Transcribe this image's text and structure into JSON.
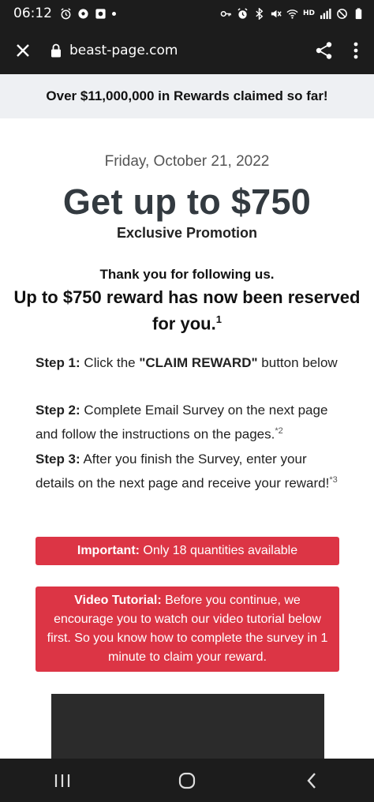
{
  "status_bar": {
    "time": "06:12",
    "hd_label": "HD",
    "icons_left": [
      "alarm-icon",
      "soccer-ball-icon",
      "app-notification-icon",
      "dot-icon"
    ],
    "icons_right": [
      "key-icon",
      "alarm-icon",
      "bluetooth-icon",
      "mute-icon",
      "wifi-icon",
      "signal-icon",
      "dnd-icon",
      "battery-icon"
    ]
  },
  "browser": {
    "url": "beast-page.com",
    "icons": [
      "close-icon",
      "lock-icon",
      "share-icon",
      "more-vert-icon"
    ]
  },
  "banner": {
    "text": "Over $11,000,000 in Rewards claimed so far!"
  },
  "page": {
    "date": "Friday, October 21, 2022",
    "headline": "Get up to $750",
    "subheadline": "Exclusive Promotion",
    "thanks": "Thank you for following us.",
    "reserved_text": "Up to $750 reward has now been reserved for you.",
    "reserved_sup": "1"
  },
  "steps": [
    {
      "label": "Step 1:",
      "before": " Click the ",
      "bold": "\"CLAIM REWARD\"",
      "after": " button below",
      "sup": ""
    },
    {
      "label": "Step 2:",
      "text": " Complete Email Survey on the next page and follow the instructions on the pages.",
      "sup": "*2"
    },
    {
      "label": "Step 3:",
      "text": " After you finish the Survey, enter your details on the next page and receive your reward!",
      "sup": "*3"
    }
  ],
  "alerts": {
    "important_label": "Important:",
    "important_text": " Only 18 quantities available",
    "video_label": "Video Tutorial:",
    "video_text": " Before you continue, we encourage you to watch our video tutorial below first. So you know how to complete the survey in 1 minute to claim your reward."
  },
  "nav": {
    "icons": [
      "recent-apps-icon",
      "home-icon",
      "back-icon"
    ]
  },
  "colors": {
    "status_bg": "#1c1c1c",
    "banner_bg": "#eef0f3",
    "alert_red": "#dc3545",
    "headline": "#333a40"
  }
}
